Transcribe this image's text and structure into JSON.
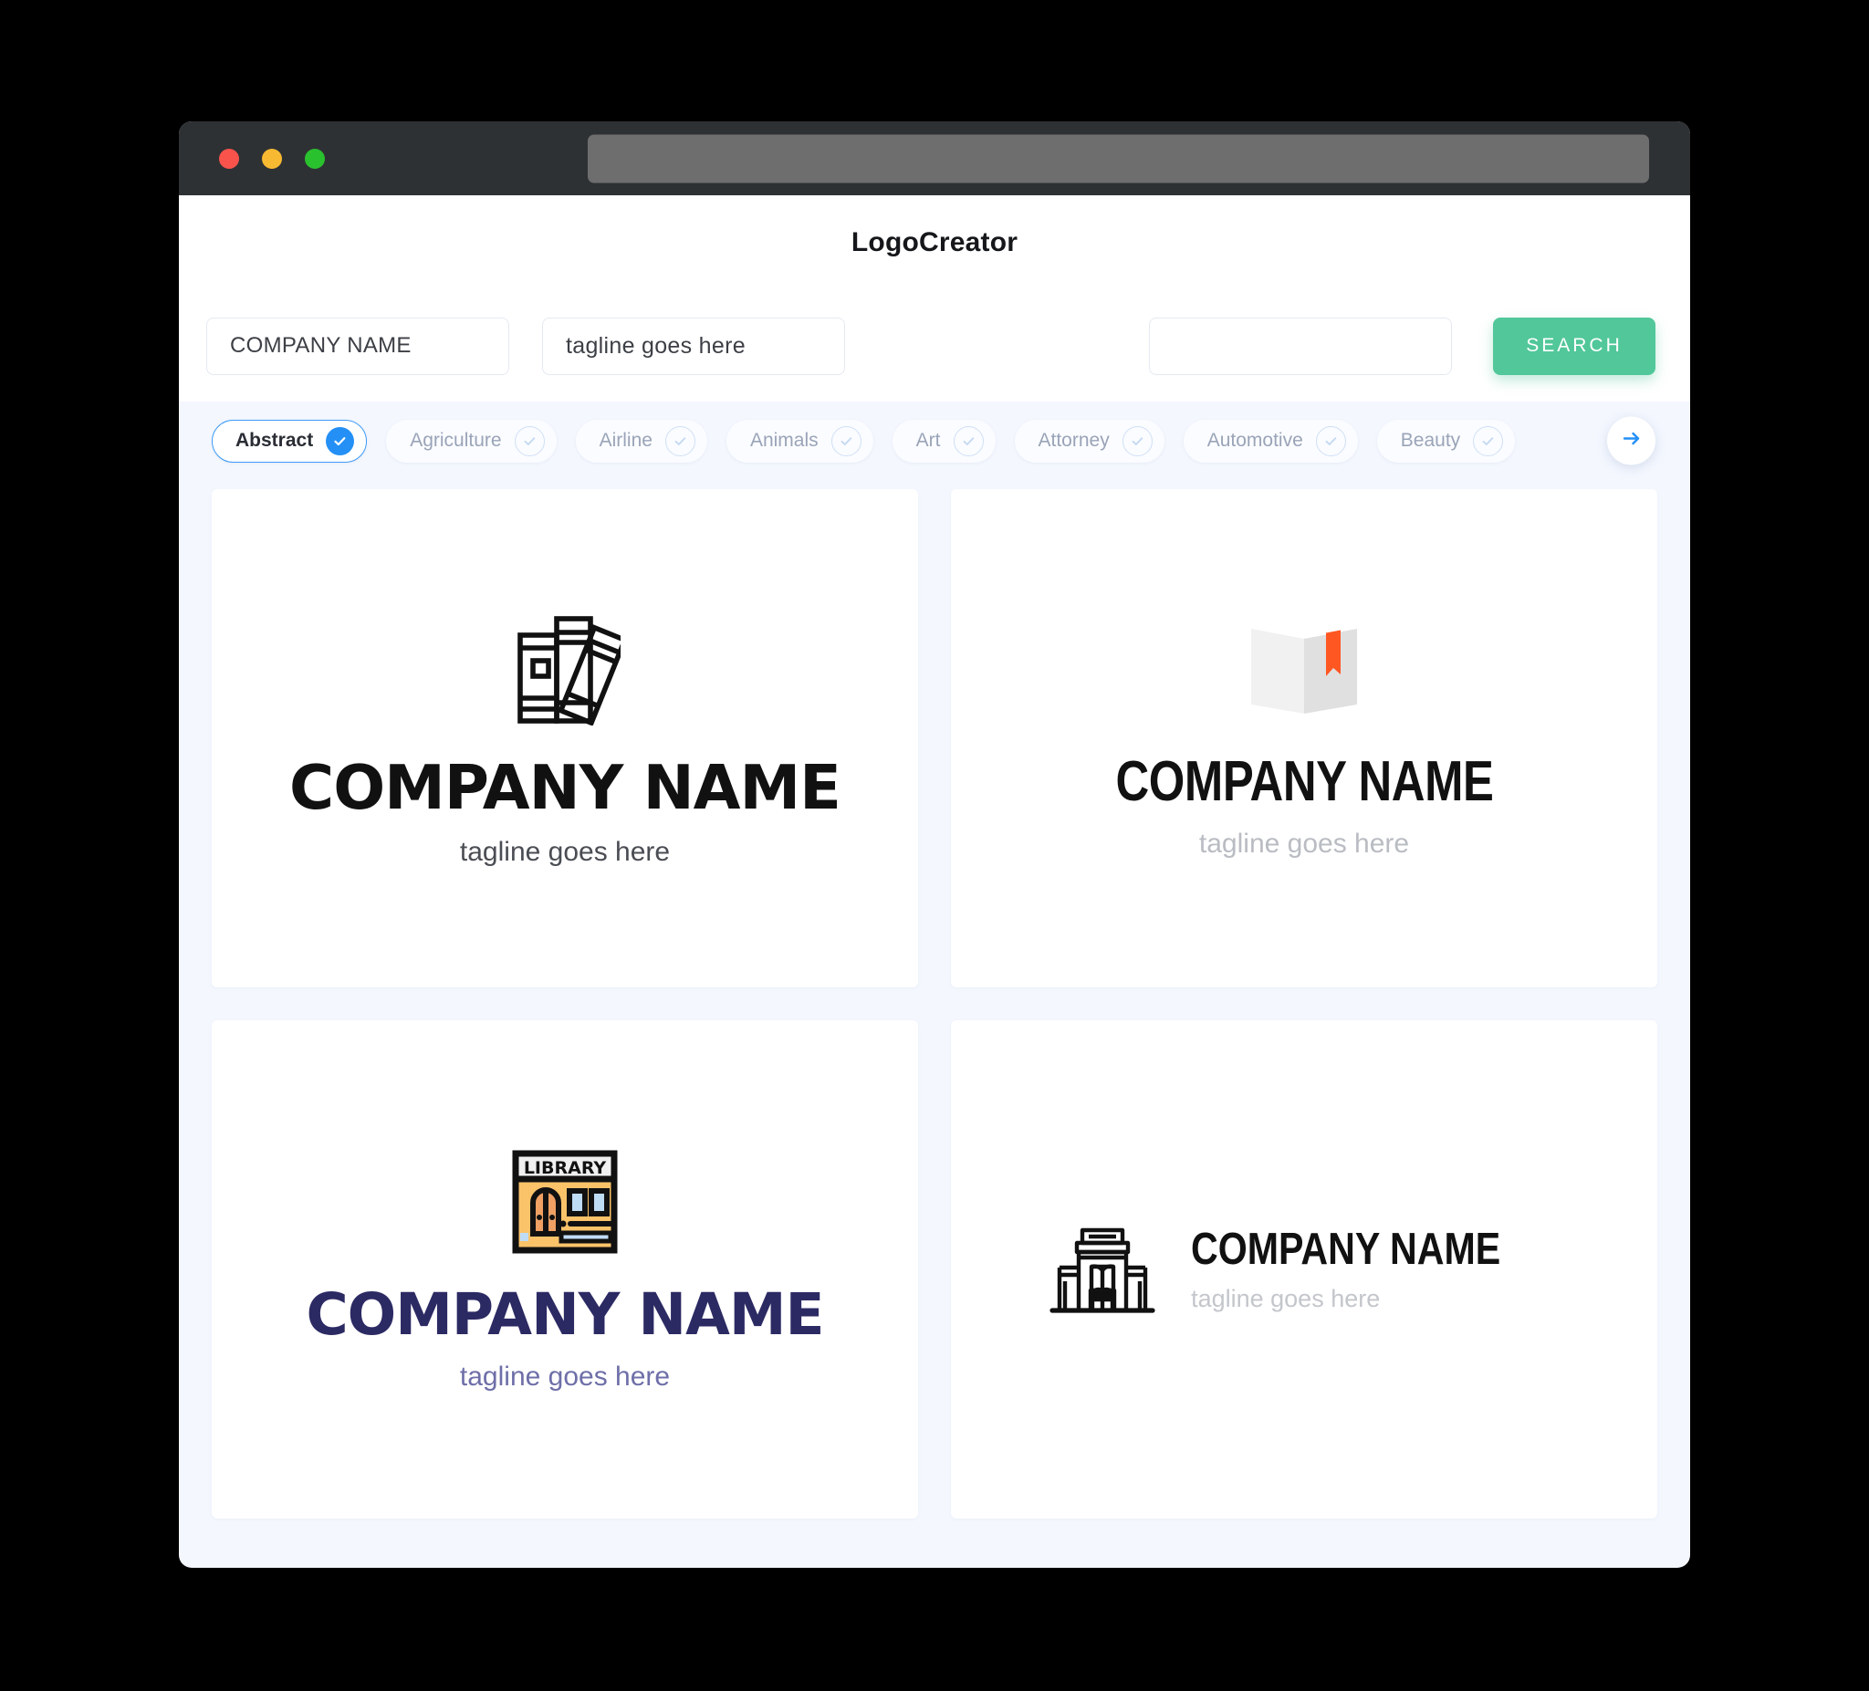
{
  "browser": {
    "traffic_lights": [
      "close-red",
      "minimize-yellow",
      "maximize-green"
    ],
    "url_value": "",
    "url_placeholder": ""
  },
  "app": {
    "title": "LogoCreator"
  },
  "search": {
    "company_value": "COMPANY NAME",
    "company_placeholder": "COMPANY NAME",
    "tagline_value": "tagline goes here",
    "tagline_placeholder": "tagline goes here",
    "extra_value": "",
    "extra_placeholder": "",
    "button_label": "SEARCH",
    "button_color": "#51c79a"
  },
  "categories": {
    "selected": "Abstract",
    "accent_color": "#2490f5",
    "items": [
      {
        "label": "Abstract",
        "selected": true
      },
      {
        "label": "Agriculture",
        "selected": false
      },
      {
        "label": "Airline",
        "selected": false
      },
      {
        "label": "Animals",
        "selected": false
      },
      {
        "label": "Art",
        "selected": false
      },
      {
        "label": "Attorney",
        "selected": false
      },
      {
        "label": "Automotive",
        "selected": false
      },
      {
        "label": "Beauty",
        "selected": false
      }
    ],
    "next_arrow": "arrow-right-icon"
  },
  "results": [
    {
      "icon": "books-outline-icon",
      "name": "COMPANY NAME",
      "tagline": "tagline goes here",
      "name_color": "#111111",
      "tagline_color": "#4a4d53",
      "layout": "stacked"
    },
    {
      "icon": "open-book-bookmark-icon",
      "name": "COMPANY NAME",
      "tagline": "tagline goes here",
      "name_color": "#111111",
      "tagline_color": "#b9bcc2",
      "layout": "stacked"
    },
    {
      "icon": "library-storefront-icon",
      "icon_sign_text": "LIBRARY",
      "name": "COMPANY NAME",
      "tagline": "tagline goes here",
      "name_color": "#2c2a63",
      "tagline_color": "#6e6fa8",
      "layout": "stacked"
    },
    {
      "icon": "library-building-book-icon",
      "name": "COMPANY NAME",
      "tagline": "tagline goes here",
      "name_color": "#111111",
      "tagline_color": "#c3c6cb",
      "layout": "horizontal"
    }
  ]
}
